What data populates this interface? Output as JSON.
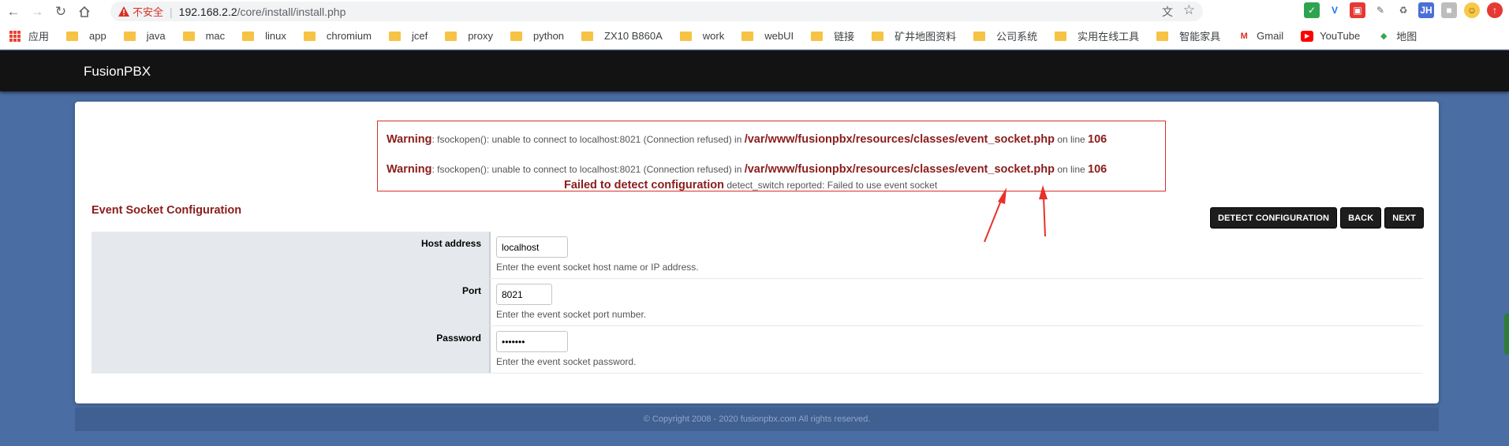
{
  "browser": {
    "security_label": "不安全",
    "url_host": "192.168.2.2",
    "url_path": "/core/install/install.php",
    "bookmarks": [
      {
        "label": "应用",
        "type": "apps"
      },
      {
        "label": "app",
        "type": "folder"
      },
      {
        "label": "java",
        "type": "folder"
      },
      {
        "label": "mac",
        "type": "folder"
      },
      {
        "label": "linux",
        "type": "folder"
      },
      {
        "label": "chromium",
        "type": "folder"
      },
      {
        "label": "jcef",
        "type": "folder"
      },
      {
        "label": "proxy",
        "type": "folder"
      },
      {
        "label": "python",
        "type": "folder"
      },
      {
        "label": "ZX10 B860A",
        "type": "folder"
      },
      {
        "label": "work",
        "type": "folder"
      },
      {
        "label": "webUI",
        "type": "folder"
      },
      {
        "label": "链接",
        "type": "folder"
      },
      {
        "label": "矿井地图资料",
        "type": "folder"
      },
      {
        "label": "公司系统",
        "type": "folder"
      },
      {
        "label": "实用在线工具",
        "type": "folder"
      },
      {
        "label": "智能家具",
        "type": "folder"
      },
      {
        "label": "Gmail",
        "type": "gmail-icon"
      },
      {
        "label": "YouTube",
        "type": "youtube-icon"
      },
      {
        "label": "地图",
        "type": "maps-icon"
      }
    ]
  },
  "header": {
    "brand": "FusionPBX"
  },
  "warnings": {
    "line1": {
      "prefix": "Warning",
      "message": ": fsockopen(): unable to connect to localhost:8021 (Connection refused) in ",
      "file": "/var/www/fusionpbx/resources/classes/event_socket.php",
      "on_line": " on line ",
      "line_no": "106"
    },
    "line2": {
      "prefix": "Warning",
      "message": ": fsockopen(): unable to connect to localhost:8021 (Connection refused) in ",
      "file": "/var/www/fusionpbx/resources/classes/event_socket.php",
      "on_line": " on line ",
      "line_no": "106"
    },
    "failed_title": "Failed to detect configuration",
    "failed_detail": " detect_switch reported: Failed to use event socket"
  },
  "section_title": "Event Socket Configuration",
  "buttons": {
    "detect": "DETECT CONFIGURATION",
    "back": "BACK",
    "next": "NEXT"
  },
  "form": {
    "host": {
      "label": "Host address",
      "value": "localhost",
      "hint": "Enter the event socket host name or IP address."
    },
    "port": {
      "label": "Port",
      "value": "8021",
      "hint": "Enter the event socket port number."
    },
    "password": {
      "label": "Password",
      "value": "ClueCon",
      "hint": "Enter the event socket password."
    }
  },
  "footer": "© Copyright 2008 - 2020 fusionpbx.com All rights reserved.",
  "colors": {
    "accent_dark_red": "#8b1c1c",
    "warning_border": "#d9312a",
    "background_blue": "#4a6ea3",
    "topbar": "#131313",
    "annotation_arrow": "#e8312a"
  }
}
